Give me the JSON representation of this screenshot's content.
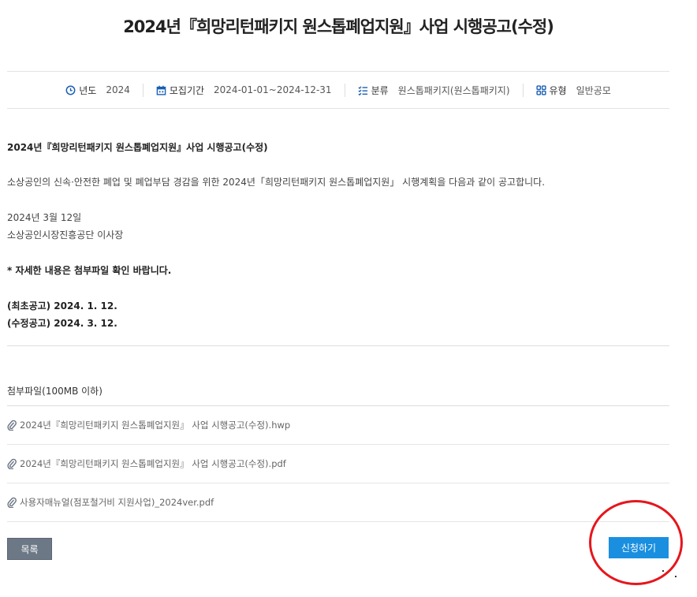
{
  "page": {
    "title": "2024년『희망리턴패키지 원스톱폐업지원』사업 시행공고(수정)"
  },
  "meta": {
    "year_label": "년도",
    "year_value": "2024",
    "period_label": "모집기간",
    "period_value": "2024-01-01~2024-12-31",
    "category_label": "분류",
    "category_value": "원스톱패키지(원스톱패키지)",
    "type_label": "유형",
    "type_value": "일반공모",
    "icon_year": "clock-icon",
    "icon_period": "calendar-icon",
    "icon_category": "checklist-icon",
    "icon_type": "grid-icon",
    "accent_color": "#1a5fb4"
  },
  "content": {
    "heading": "2024년『희망리턴패키지 원스톱폐업지원』사업 시행공고(수정)",
    "intro": "소상공인의 신속·안전한 폐업 및 폐업부담 경감을 위한 2024년「희망리턴패키지 원스톱폐업지원」 시행계획을 다음과 같이 공고합니다.",
    "date": "2024년 3월 12일",
    "issuer": "소상공인시장진흥공단 이사장",
    "notice": "* 자세한 내용은 첨부파일 확인 바랍니다.",
    "initial": "(최초공고) 2024. 1. 12.",
    "revised": "(수정공고) 2024. 3. 12."
  },
  "attachments": {
    "title": "첨부파일(100MB 이하)",
    "icon": "paperclip-icon",
    "files": [
      "2024년『희망리턴패키지 원스톱폐업지원』 사업 시행공고(수정).hwp",
      "2024년『희망리턴패키지 원스톱폐업지원』 사업 시행공고(수정).pdf",
      "사용자매뉴얼(점포철거비 지원사업)_2024ver.pdf"
    ]
  },
  "buttons": {
    "list": "목록",
    "apply": "신청하기",
    "list_color": "#6d7886",
    "apply_color": "#1a8fe0"
  },
  "annotation": {
    "circle_color": "#e6161c"
  }
}
